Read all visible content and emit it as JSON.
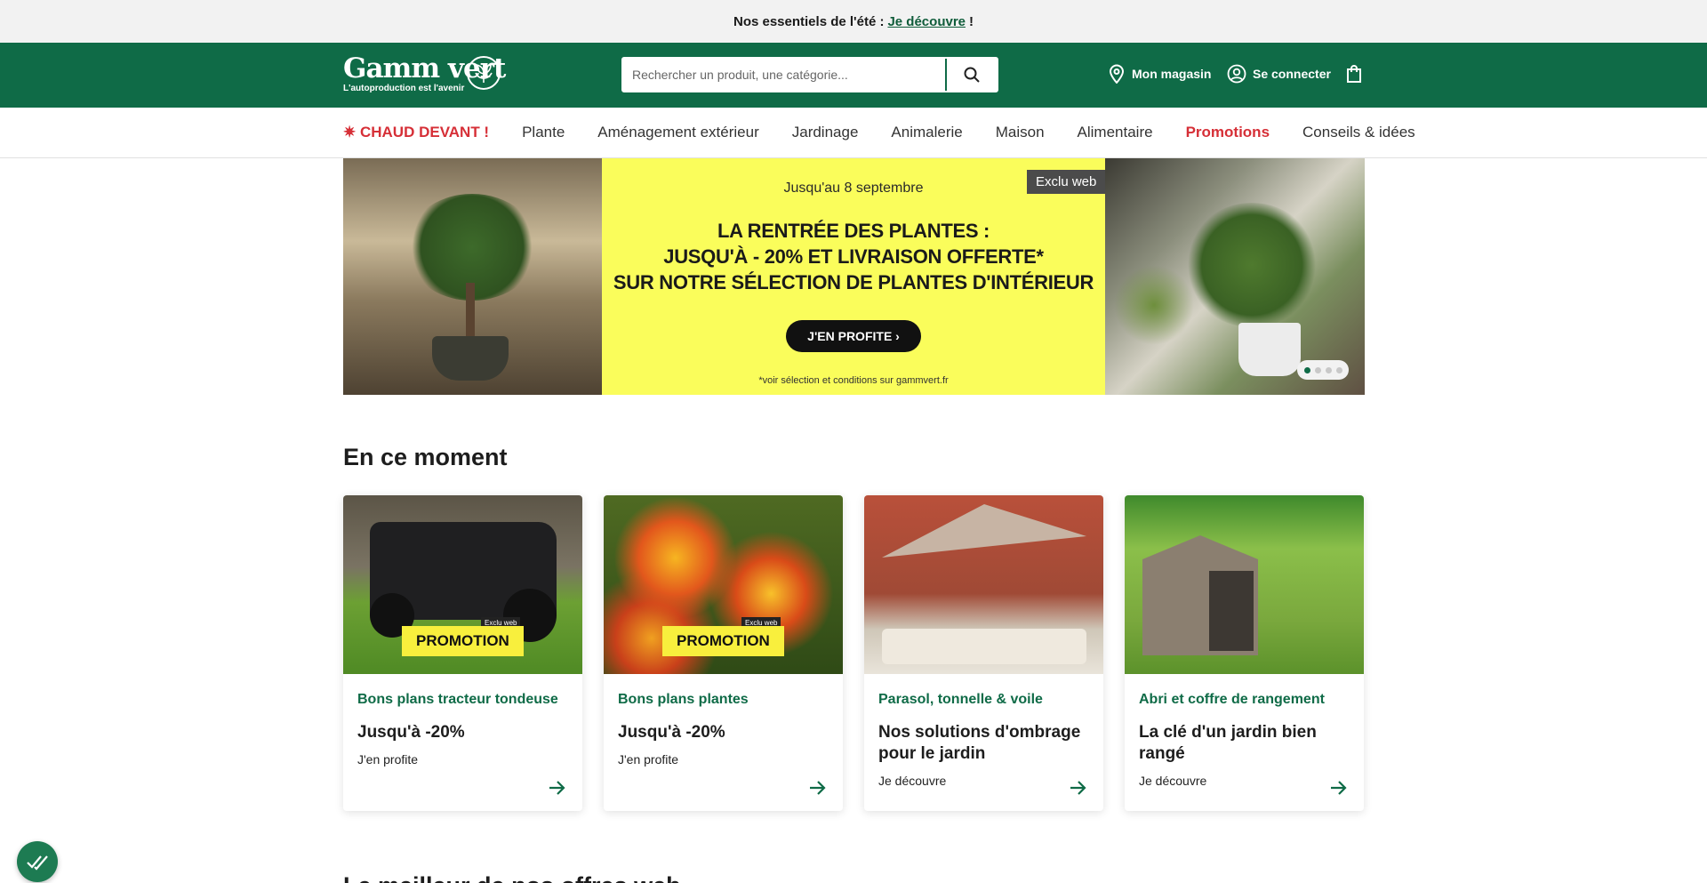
{
  "announcement": {
    "prefix": "Nos essentiels de l'été :",
    "link": "Je découvre",
    "suffix": "!"
  },
  "header": {
    "logo_main": "Gamm vert",
    "logo_tagline": "L'autoproduction est l'avenir",
    "search_placeholder": "Rechercher un produit, une catégorie...",
    "store_label": "Mon magasin",
    "login_label": "Se connecter"
  },
  "nav": {
    "items": [
      "CHAUD DEVANT !",
      "Plante",
      "Aménagement extérieur",
      "Jardinage",
      "Animalerie",
      "Maison",
      "Alimentaire",
      "Promotions",
      "Conseils & idées"
    ]
  },
  "hero": {
    "date": "Jusqu'au 8 septembre",
    "title_line1": "LA RENTRÉE DES PLANTES :",
    "title_line2": "JUSQU'À - 20% ET LIVRAISON OFFERTE*",
    "title_line3": "SUR NOTRE SÉLECTION DE PLANTES D'INTÉRIEUR",
    "cta": "J'EN PROFITE",
    "note": "*voir sélection et conditions sur gammvert.fr",
    "exclu": "Exclu web",
    "slides": 4,
    "active_slide": 1
  },
  "section_title": "En ce moment",
  "cards": [
    {
      "badge": "PROMOTION",
      "mini": "Exclu web",
      "category": "Bons plans tracteur tondeuse",
      "title": "Jusqu'à -20%",
      "link": "J'en profite"
    },
    {
      "badge": "PROMOTION",
      "mini": "Exclu web",
      "category": "Bons plans plantes",
      "title": "Jusqu'à -20%",
      "link": "J'en profite"
    },
    {
      "category": "Parasol, tonnelle & voile",
      "title": "Nos solutions d'ombrage pour le jardin",
      "link": "Je découvre"
    },
    {
      "category": "Abri et coffre de rangement",
      "title": "La clé d'un jardin bien rangé",
      "link": "Je découvre"
    }
  ],
  "next_section_title": "Le meilleur de nos offres web",
  "colors": {
    "brand_green": "#0f6b47",
    "promo_red": "#d62f37",
    "banner_yellow": "#fafd5b",
    "badge_yellow": "#f8ef3d"
  }
}
